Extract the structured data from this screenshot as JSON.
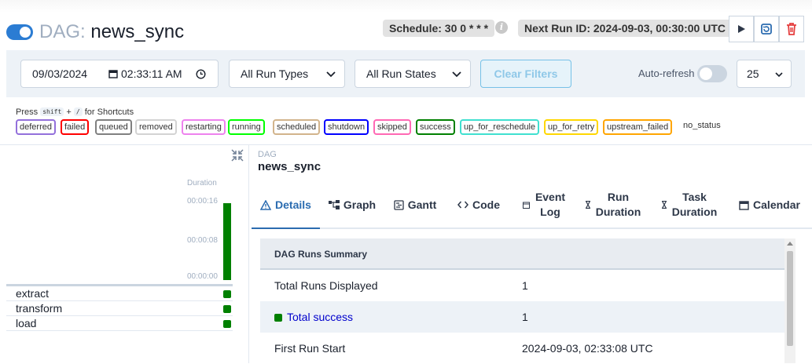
{
  "header": {
    "dag_prefix": "DAG:",
    "dag_id": "news_sync",
    "schedule": "Schedule: 30 0 * * *",
    "next_run": "Next Run ID: 2024-09-03, 00:30:00 UTC",
    "info_glyph": "i"
  },
  "filters": {
    "date": "09/03/2024",
    "time": "02:33:11 AM",
    "run_types": "All Run Types",
    "run_states": "All Run States",
    "clear": "Clear Filters",
    "auto_refresh": "Auto-refresh",
    "page_size": "25"
  },
  "legend": {
    "press": "Press",
    "key1": "shift",
    "plus": "+",
    "key2": "/",
    "for": "for Shortcuts",
    "states": [
      {
        "label": "deferred",
        "color": "#9370db"
      },
      {
        "label": "failed",
        "color": "#ff0000"
      },
      {
        "label": "queued",
        "color": "#808080"
      },
      {
        "label": "removed",
        "color": "#d3d3d3"
      },
      {
        "label": "restarting",
        "color": "#ee82ee"
      },
      {
        "label": "running",
        "color": "#00ff00"
      },
      {
        "label": "scheduled",
        "color": "#d2b48c"
      },
      {
        "label": "shutdown",
        "color": "#0000ff"
      },
      {
        "label": "skipped",
        "color": "#ff69b4"
      },
      {
        "label": "success",
        "color": "#008000"
      },
      {
        "label": "up_for_reschedule",
        "color": "#40e0d0"
      },
      {
        "label": "up_for_retry",
        "color": "#ffd700"
      },
      {
        "label": "upstream_failed",
        "color": "#ffa500"
      },
      {
        "label": "no_status",
        "color": ""
      }
    ]
  },
  "grid": {
    "duration_label": "Duration",
    "ticks": [
      "00:00:16",
      "00:00:08",
      "00:00:00"
    ],
    "tasks": [
      "extract",
      "transform",
      "load"
    ],
    "run_duration_fraction": 1.0
  },
  "details": {
    "dag_label": "DAG",
    "dag_name": "news_sync",
    "tabs": [
      {
        "label": "Details",
        "icon": "warning-triangle-icon"
      },
      {
        "label": "Graph",
        "icon": "graph-icon"
      },
      {
        "label": "Gantt",
        "icon": "gantt-icon"
      },
      {
        "label": "Code",
        "icon": "code-icon"
      },
      {
        "label": "Event Log",
        "icon": "calendar-small-icon"
      },
      {
        "label": "Run Duration",
        "icon": "hourglass-icon"
      },
      {
        "label": "Task Duration",
        "icon": "hourglass-icon"
      },
      {
        "label": "Calendar",
        "icon": "calendar-icon"
      }
    ],
    "summary_title": "DAG Runs Summary",
    "rows": [
      {
        "key": "Total Runs Displayed",
        "value": "1"
      },
      {
        "key": "Total success",
        "value": "1"
      },
      {
        "key": "First Run Start",
        "value": "2024-09-03, 02:33:08 UTC"
      }
    ]
  },
  "colors": {
    "accent": "#2b7cd3",
    "success": "#008000",
    "link": "#0000cc"
  }
}
